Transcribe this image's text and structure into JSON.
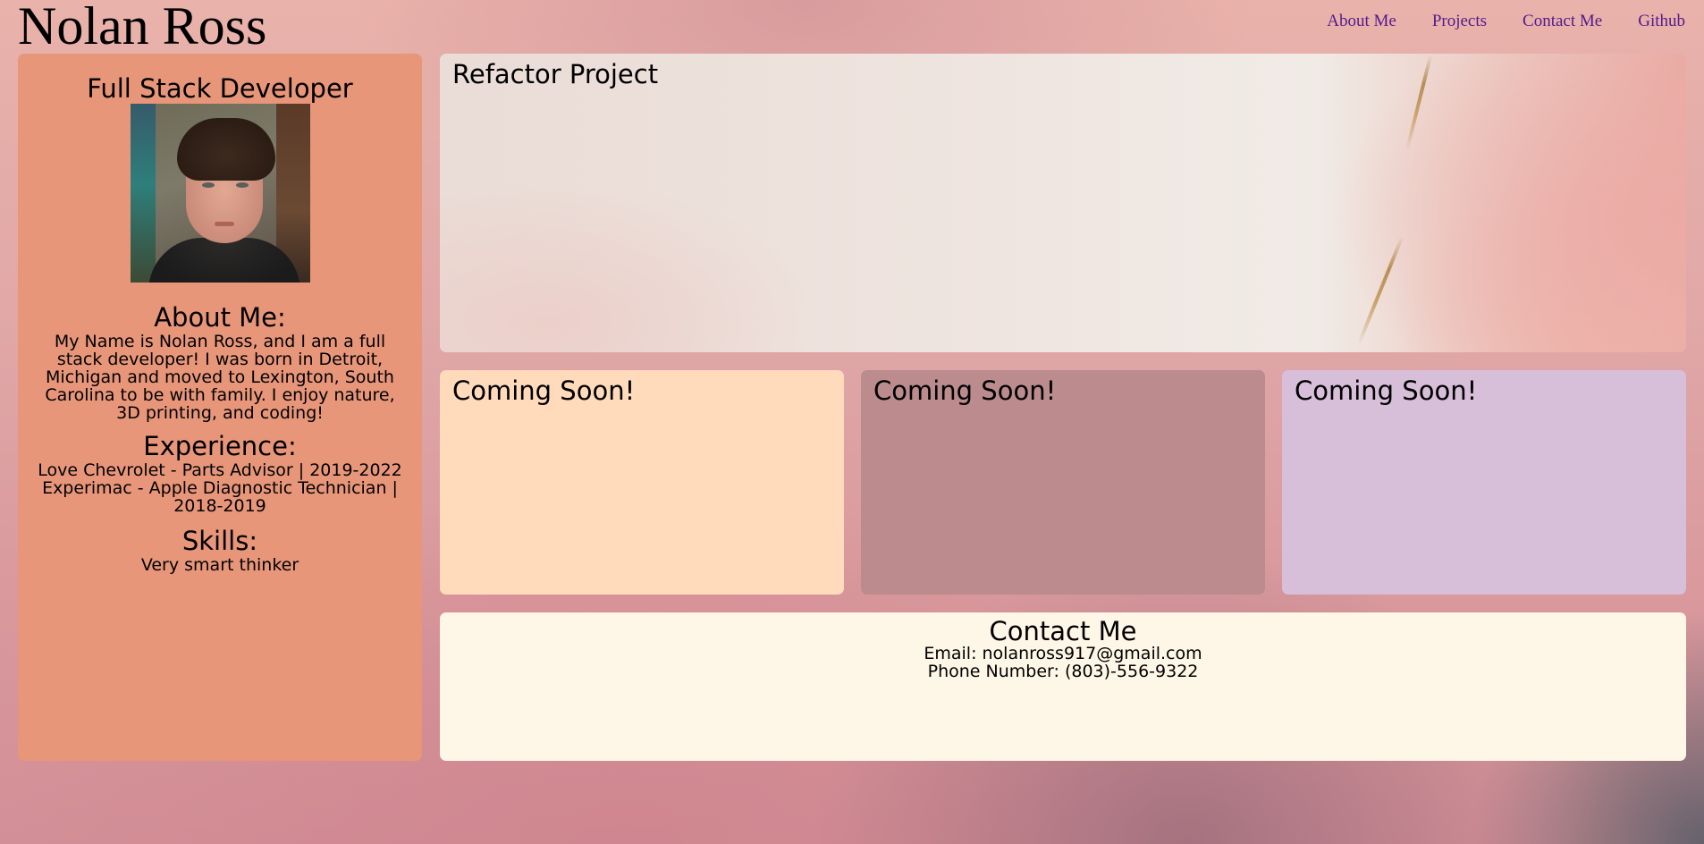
{
  "header": {
    "site_title": "Nolan Ross",
    "nav": [
      "About Me",
      "Projects",
      "Contact Me",
      "Github"
    ]
  },
  "sidebar": {
    "title": "Full Stack Developer",
    "about_heading": "About Me:",
    "about_text": "My Name is Nolan Ross, and I am a full stack developer! I was born in Detroit, Michigan and moved to Lexington, South Carolina to be with family. I enjoy nature, 3D printing, and coding!",
    "experience_heading": "Experience:",
    "experience": [
      "Love Chevrolet - Parts Advisor | 2019-2022",
      "Experimac - Apple Diagnostic Technician | 2018-2019"
    ],
    "skills_heading": "Skills:",
    "skills": [
      "Very smart thinker"
    ]
  },
  "projects": {
    "main_title": "Refactor Project",
    "cards": [
      "Coming Soon!",
      "Coming Soon!",
      "Coming Soon!"
    ]
  },
  "contact": {
    "heading": "Contact Me",
    "email": "Email: nolanross917@gmail.com",
    "phone": "Phone Number: (803)-556-9322"
  },
  "colors": {
    "sidebar_bg": "#e8967a",
    "card1_bg": "#ffdbbb",
    "card2_bg": "#bb8b8e",
    "card3_bg": "#d7bed9",
    "contact_bg": "#fef6e6",
    "nav_link": "#551a8b"
  }
}
